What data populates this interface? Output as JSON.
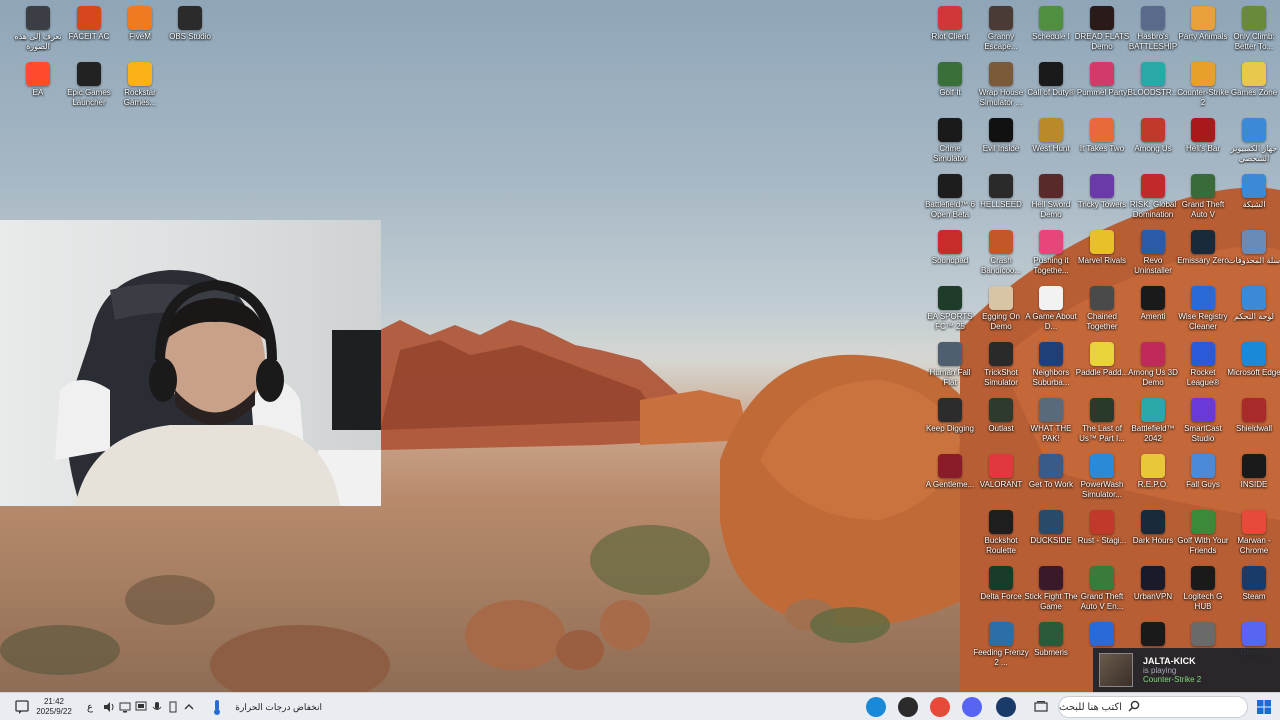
{
  "desktop_icons_left": [
    {
      "label": "تعرف إلى هذه الصورة",
      "icon": "info-circle-icon",
      "color": "#3b3f45"
    },
    {
      "label": "FACEIT AC",
      "icon": "faceit-icon",
      "color": "#d6461f"
    },
    {
      "label": "FiveM",
      "icon": "fivem-icon",
      "color": "#f07a22"
    },
    {
      "label": "OBS Studio",
      "icon": "obs-icon",
      "color": "#2b2b2b"
    },
    {
      "label": "EA",
      "icon": "ea-icon",
      "color": "#ff4b2b"
    },
    {
      "label": "Epic Games Launcher",
      "icon": "epic-games-icon",
      "color": "#222222"
    },
    {
      "label": "Rockstar Games...",
      "icon": "rockstar-icon",
      "color": "#fbb216"
    }
  ],
  "desktop_icons_right": [
    [
      {
        "label": "Riot Client",
        "color": "#d13639"
      },
      {
        "label": "Golf It",
        "color": "#3a6f3a"
      },
      {
        "label": "Crime Simulator",
        "color": "#1a1a1a"
      },
      {
        "label": "Battlefield™ 6 Open Beta",
        "color": "#1d1d1d"
      },
      {
        "label": "Soundpad",
        "color": "#c92a2a"
      },
      {
        "label": "EA SPORTS FC™ 25",
        "color": "#1f3b2a"
      },
      {
        "label": "Human Fall Flat",
        "color": "#4f5f6f"
      },
      {
        "label": "Keep Digging",
        "color": "#2c2c2c"
      },
      {
        "label": "A Gentleme...",
        "color": "#8a1c2a"
      },
      {
        "label": "",
        "color": ""
      },
      {
        "label": "",
        "color": ""
      },
      {
        "label": "",
        "color": ""
      }
    ],
    [
      {
        "label": "Granny Escape...",
        "color": "#4a3b34"
      },
      {
        "label": "Wrap House Simulator ...",
        "color": "#7b5a3a"
      },
      {
        "label": "Evil Inside",
        "color": "#111111"
      },
      {
        "label": "HELLSEED",
        "color": "#2a2a2a"
      },
      {
        "label": "Crash Bandicoo...",
        "color": "#c4572a"
      },
      {
        "label": "Egging On Demo",
        "color": "#d9c4a6"
      },
      {
        "label": "TrickShot Simulator",
        "color": "#2a2a2a"
      },
      {
        "label": "Outlast",
        "color": "#2d3a2d"
      },
      {
        "label": "VALORANT",
        "color": "#e0383e"
      },
      {
        "label": "Buckshot Roulette",
        "color": "#1e1e1e"
      },
      {
        "label": "Delta Force",
        "color": "#1a3a2a"
      },
      {
        "label": "Feeding Frenzy 2 ...",
        "color": "#2a6fa8"
      }
    ],
    [
      {
        "label": "Schedule I",
        "color": "#4f8f3f"
      },
      {
        "label": "Call of Duty®",
        "color": "#1a1a1a"
      },
      {
        "label": "West Hunt",
        "color": "#b88a2a"
      },
      {
        "label": "Hell Sword Demo",
        "color": "#5a2a2a"
      },
      {
        "label": "Pushing it Togethe...",
        "color": "#e8457a"
      },
      {
        "label": "A Game About D...",
        "color": "#f2f2f2"
      },
      {
        "label": "Neighbors Suburba...",
        "color": "#1f3f7a"
      },
      {
        "label": "WHAT THE PAK!",
        "color": "#5a6a7a"
      },
      {
        "label": "Get To Work",
        "color": "#3a5a8a"
      },
      {
        "label": "DUCKSIDE",
        "color": "#2a4a6a"
      },
      {
        "label": "Stick Fight The Game",
        "color": "#3a1a2a"
      },
      {
        "label": "Submeris",
        "color": "#2a5a3a"
      }
    ],
    [
      {
        "label": "DREAD FLATS Demo",
        "color": "#2a1a1a"
      },
      {
        "label": "Pummel Party",
        "color": "#d23a6a"
      },
      {
        "label": "It Takes Two",
        "color": "#e86a3a"
      },
      {
        "label": "Tricky Towers",
        "color": "#6a3aa8"
      },
      {
        "label": "Marvel Rivals",
        "color": "#e8c02a"
      },
      {
        "label": "Chained Together",
        "color": "#4a4a4a"
      },
      {
        "label": "Paddle Padd...",
        "color": "#e8d43a"
      },
      {
        "label": "The Last of Us™ Part I...",
        "color": "#2a3a2a"
      },
      {
        "label": "PowerWash Simulator...",
        "color": "#2a8ad8"
      },
      {
        "label": "Rust - Stagi...",
        "color": "#c0392b"
      },
      {
        "label": "Grand Theft Auto V En...",
        "color": "#3a7a3a"
      },
      {
        "label": "",
        "color": "#2a6ad8"
      }
    ],
    [
      {
        "label": "Hasbro's BATTLESHIP",
        "color": "#5a6a8a"
      },
      {
        "label": "BLOODSTR...",
        "color": "#2aa8a8"
      },
      {
        "label": "Among Us",
        "color": "#c0392b"
      },
      {
        "label": "RISK: Global Domination",
        "color": "#c02a2a"
      },
      {
        "label": "Revo Uninstaller",
        "color": "#2a5aa8"
      },
      {
        "label": "Amenti",
        "color": "#1a1a1a"
      },
      {
        "label": "Among Us 3D Demo",
        "color": "#c02a5a"
      },
      {
        "label": "Battlefield™ 2042",
        "color": "#2aa8a8"
      },
      {
        "label": "R.E.P.O.",
        "color": "#e8c83a"
      },
      {
        "label": "Dark Hours",
        "color": "#1a2a3a"
      },
      {
        "label": "UrbanVPN",
        "color": "#1a1a2a"
      },
      {
        "label": "",
        "color": "#1a1a1a"
      }
    ],
    [
      {
        "label": "Party Animals",
        "color": "#e8a03a"
      },
      {
        "label": "Counter-Strike 2",
        "color": "#e8a02a"
      },
      {
        "label": "Hell's Bar",
        "color": "#a81a1a"
      },
      {
        "label": "Grand Theft Auto V",
        "color": "#3a6a3a"
      },
      {
        "label": "Emissary Zero",
        "color": "#1a2a3a"
      },
      {
        "label": "Wise Registry Cleaner",
        "color": "#2a6ad8"
      },
      {
        "label": "Rocket League®",
        "color": "#2a5ad8"
      },
      {
        "label": "SmartCast Studio",
        "color": "#6a3ad8"
      },
      {
        "label": "Fall Guys",
        "color": "#4a8ad8"
      },
      {
        "label": "Golf With Your Friends",
        "color": "#3a8a3a"
      },
      {
        "label": "Logitech G HUB",
        "color": "#1a1a1a"
      },
      {
        "label": "",
        "color": "#6a6a6a"
      }
    ],
    [
      {
        "label": "Only Climb: Better To...",
        "color": "#6a8a3a"
      },
      {
        "label": "Games Zone",
        "color": "#e8c84a"
      },
      {
        "label": "جهاز الكمبيوتر الشخصي",
        "color": "#3a8ad8"
      },
      {
        "label": "الشبكة",
        "color": "#3a8ad8"
      },
      {
        "label": "سلة المحذوفات",
        "color": "#6a8ab8"
      },
      {
        "label": "لوحة التحكم",
        "color": "#3a8ad8"
      },
      {
        "label": "Microsoft Edge",
        "color": "#1a8ad8"
      },
      {
        "label": "Shieldwall",
        "color": "#a82a2a"
      },
      {
        "label": "INSIDE",
        "color": "#1a1a1a"
      },
      {
        "label": "Marwan - Chrome",
        "color": "#e84a3a"
      },
      {
        "label": "Steam",
        "color": "#1a3a6a"
      },
      {
        "label": "Discord",
        "color": "#5865f2"
      }
    ]
  ],
  "notification": {
    "name": "JALTA-KICK",
    "status": "is playing",
    "game": "Counter-Strike 2"
  },
  "taskbar": {
    "time": "21:42",
    "date": "2025/9/22",
    "lang": "ع",
    "weather_text": "انخفاض درجات الحرارة",
    "search_placeholder": "اكتب هنا للبحث",
    "pinned": [
      {
        "name": "edge-icon",
        "color": "#1a8ad8"
      },
      {
        "name": "obs-icon",
        "color": "#2b2b2b"
      },
      {
        "name": "chrome-icon",
        "color": "#e84a3a"
      },
      {
        "name": "discord-icon",
        "color": "#5865f2"
      },
      {
        "name": "steam-icon",
        "color": "#1a3a6a"
      }
    ]
  }
}
